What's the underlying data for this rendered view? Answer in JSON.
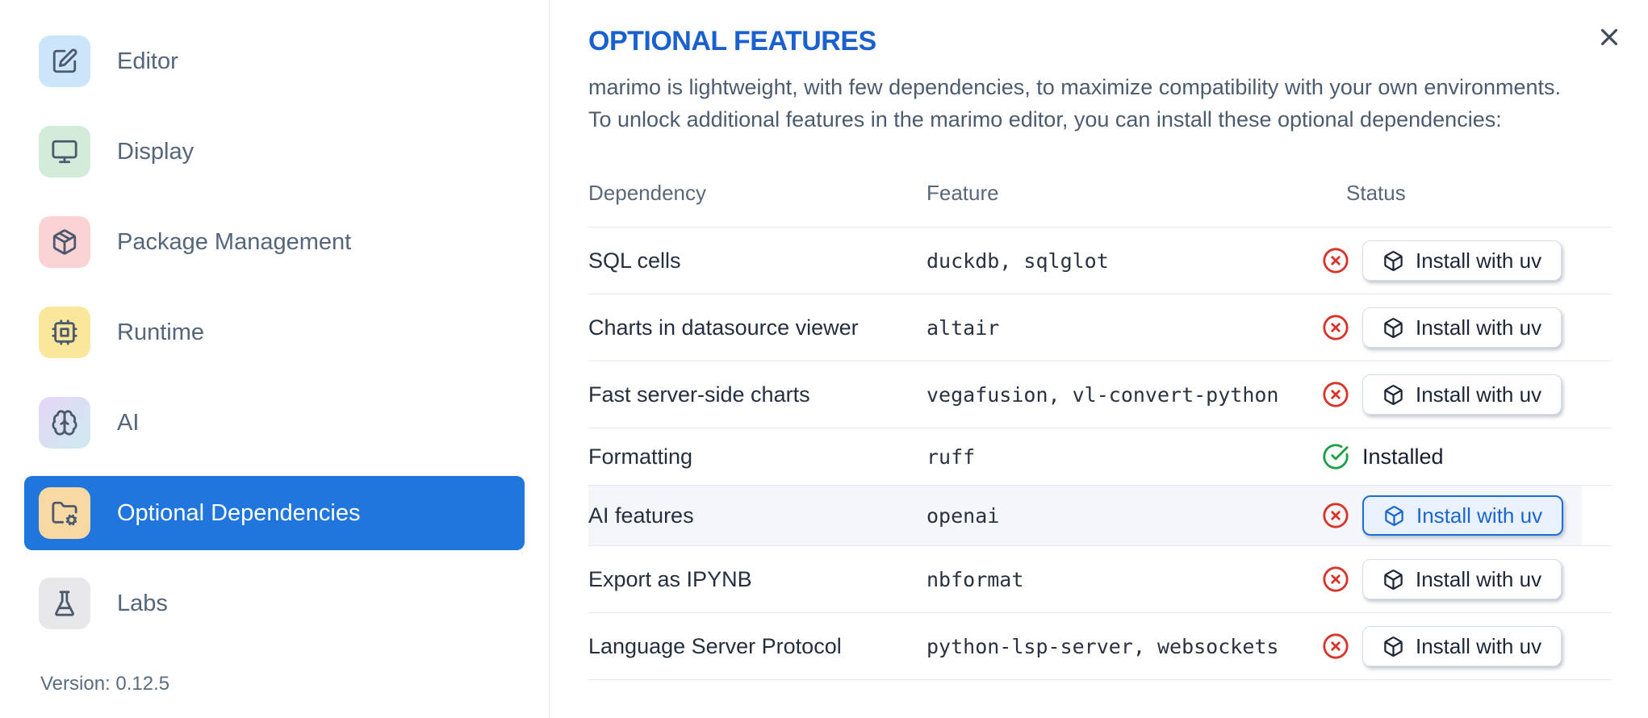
{
  "dialog": {
    "close_icon": "x"
  },
  "sidebar": {
    "items": [
      {
        "label": "Editor",
        "icon": "square-pen",
        "icon_bg": "#cde5fa",
        "selected": false
      },
      {
        "label": "Display",
        "icon": "monitor",
        "icon_bg": "#d3ecd9",
        "selected": false
      },
      {
        "label": "Package Management",
        "icon": "package",
        "icon_bg": "#fbd3d4",
        "selected": false
      },
      {
        "label": "Runtime",
        "icon": "cpu",
        "icon_bg": "#fbe79c",
        "selected": false
      },
      {
        "label": "AI",
        "icon": "brain",
        "icon_bg": "#e6d6f6",
        "icon_bg2": "#cdeaf0",
        "selected": false
      },
      {
        "label": "Optional Dependencies",
        "icon": "folder-cog",
        "icon_bg": "#f8d8a3",
        "selected": true
      },
      {
        "label": "Labs",
        "icon": "flask",
        "icon_bg": "#e8e8eb",
        "selected": false
      }
    ],
    "version": "Version: 0.12.5"
  },
  "main": {
    "title": "OPTIONAL FEATURES",
    "description_lines": [
      "marimo is lightweight, with few dependencies, to maximize compatibility with your own environments.",
      "To unlock additional features in the marimo editor, you can install these optional dependencies:"
    ],
    "table": {
      "headers": [
        "Dependency",
        "Feature",
        "Status"
      ],
      "install_button_label": "Install with uv",
      "installed_label": "Installed",
      "rows": [
        {
          "dependency": "SQL cells",
          "feature": "duckdb, sqlglot",
          "installed": false,
          "highlighted": false
        },
        {
          "dependency": "Charts in datasource viewer",
          "feature": "altair",
          "installed": false,
          "highlighted": false
        },
        {
          "dependency": "Fast server-side charts",
          "feature": "vegafusion, vl-convert-python",
          "installed": false,
          "highlighted": false
        },
        {
          "dependency": "Formatting",
          "feature": "ruff",
          "installed": true,
          "highlighted": false
        },
        {
          "dependency": "AI features",
          "feature": "openai",
          "installed": false,
          "highlighted": true
        },
        {
          "dependency": "Export as IPYNB",
          "feature": "nbformat",
          "installed": false,
          "highlighted": false
        },
        {
          "dependency": "Language Server Protocol",
          "feature": "python-lsp-server, websockets",
          "installed": false,
          "highlighted": false
        }
      ]
    }
  },
  "colors": {
    "accent_blue": "#2176dd",
    "title_blue": "#1a60ce",
    "status_red": "#d7342c",
    "status_green": "#1f9e48",
    "divider": "#e4e9f0",
    "highlight_row_bg": "#f4f6f9"
  }
}
